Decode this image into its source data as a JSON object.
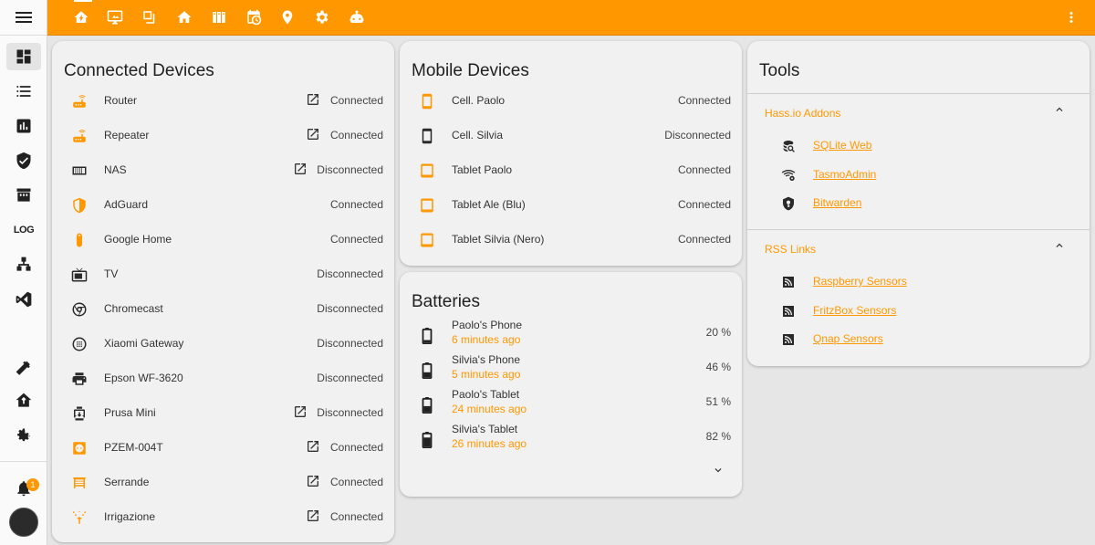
{
  "colors": {
    "accent": "#ff9800",
    "background": "#e6e6e6",
    "card": "#f1f1f1"
  },
  "sidebar": {
    "menu_icon": "hamburger-icon",
    "items": [
      {
        "icon": "dashboard-icon"
      },
      {
        "icon": "list-icon"
      },
      {
        "icon": "chart-icon"
      },
      {
        "icon": "shield-check-icon"
      },
      {
        "icon": "hacs-icon",
        "label": "HACS"
      },
      {
        "icon": "log-icon",
        "label": "LOG"
      },
      {
        "icon": "sitemap-icon"
      },
      {
        "icon": "vscode-icon"
      },
      {
        "icon": "hammer-icon"
      },
      {
        "icon": "home-assistant-icon"
      },
      {
        "icon": "gear-icon"
      }
    ],
    "notifications_count": "1"
  },
  "topbar": {
    "tabs": [
      "home-lightning-icon",
      "monitor-icon",
      "windows-icon",
      "home-icon",
      "server-icon",
      "calendar-clock-icon",
      "map-marker-icon",
      "gear-icon",
      "robot-icon"
    ],
    "menu_icon": "dots-vertical-icon"
  },
  "connected_devices": {
    "title": "Connected Devices",
    "rows": [
      {
        "name": "Router",
        "state": "Connected",
        "icon": "router-icon",
        "link": true
      },
      {
        "name": "Repeater",
        "state": "Connected",
        "icon": "router-icon",
        "link": true
      },
      {
        "name": "NAS",
        "state": "Disconnected",
        "icon": "nas-icon",
        "link": true
      },
      {
        "name": "AdGuard",
        "state": "Connected",
        "icon": "shield-icon",
        "link": false
      },
      {
        "name": "Google Home",
        "state": "Connected",
        "icon": "google-home-icon",
        "link": false
      },
      {
        "name": "TV",
        "state": "Disconnected",
        "icon": "tv-icon",
        "link": false
      },
      {
        "name": "Chromecast",
        "state": "Disconnected",
        "icon": "chromecast-icon",
        "link": false
      },
      {
        "name": "Xiaomi Gateway",
        "state": "Disconnected",
        "icon": "gateway-icon",
        "link": false
      },
      {
        "name": "Epson WF-3620",
        "state": "Disconnected",
        "icon": "printer-icon",
        "link": false
      },
      {
        "name": "Prusa Mini",
        "state": "Disconnected",
        "icon": "printer-3d-icon",
        "link": true
      },
      {
        "name": "PZEM-004T",
        "state": "Connected",
        "icon": "power-socket-icon",
        "link": true
      },
      {
        "name": "Serrande",
        "state": "Connected",
        "icon": "window-shutter-icon",
        "link": true
      },
      {
        "name": "Irrigazione",
        "state": "Connected",
        "icon": "sprinkler-icon",
        "link": true
      }
    ]
  },
  "mobile_devices": {
    "title": "Mobile Devices",
    "rows": [
      {
        "name": "Cell. Paolo",
        "state": "Connected",
        "icon": "cellphone-icon"
      },
      {
        "name": "Cell. Silvia",
        "state": "Disconnected",
        "icon": "cellphone-icon"
      },
      {
        "name": "Tablet Paolo",
        "state": "Connected",
        "icon": "tablet-icon"
      },
      {
        "name": "Tablet Ale (Blu)",
        "state": "Connected",
        "icon": "tablet-icon"
      },
      {
        "name": "Tablet Silvia (Nero)",
        "state": "Connected",
        "icon": "tablet-icon"
      }
    ]
  },
  "batteries": {
    "title": "Batteries",
    "rows": [
      {
        "name": "Paolo's Phone",
        "time": "6 minutes ago",
        "value": "20 %",
        "level": 0.2
      },
      {
        "name": "Silvia's Phone",
        "time": "5 minutes ago",
        "value": "46 %",
        "level": 0.46
      },
      {
        "name": "Paolo's Tablet",
        "time": "24 minutes ago",
        "value": "51 %",
        "level": 0.51
      },
      {
        "name": "Silvia's Tablet",
        "time": "26 minutes ago",
        "value": "82 %",
        "level": 0.82
      }
    ]
  },
  "tools": {
    "title": "Tools",
    "sections": [
      {
        "title": "Hass.io Addons",
        "links": [
          {
            "label": "SQLite Web",
            "icon": "database-search-icon"
          },
          {
            "label": "TasmoAdmin",
            "icon": "wifi-cog-icon"
          },
          {
            "label": "Bitwarden",
            "icon": "shield-key-icon"
          }
        ]
      },
      {
        "title": "RSS Links",
        "links": [
          {
            "label": "Raspberry Sensors",
            "icon": "rss-icon"
          },
          {
            "label": "FritzBox Sensors",
            "icon": "rss-icon"
          },
          {
            "label": "Qnap Sensors",
            "icon": "rss-icon"
          }
        ]
      }
    ]
  }
}
